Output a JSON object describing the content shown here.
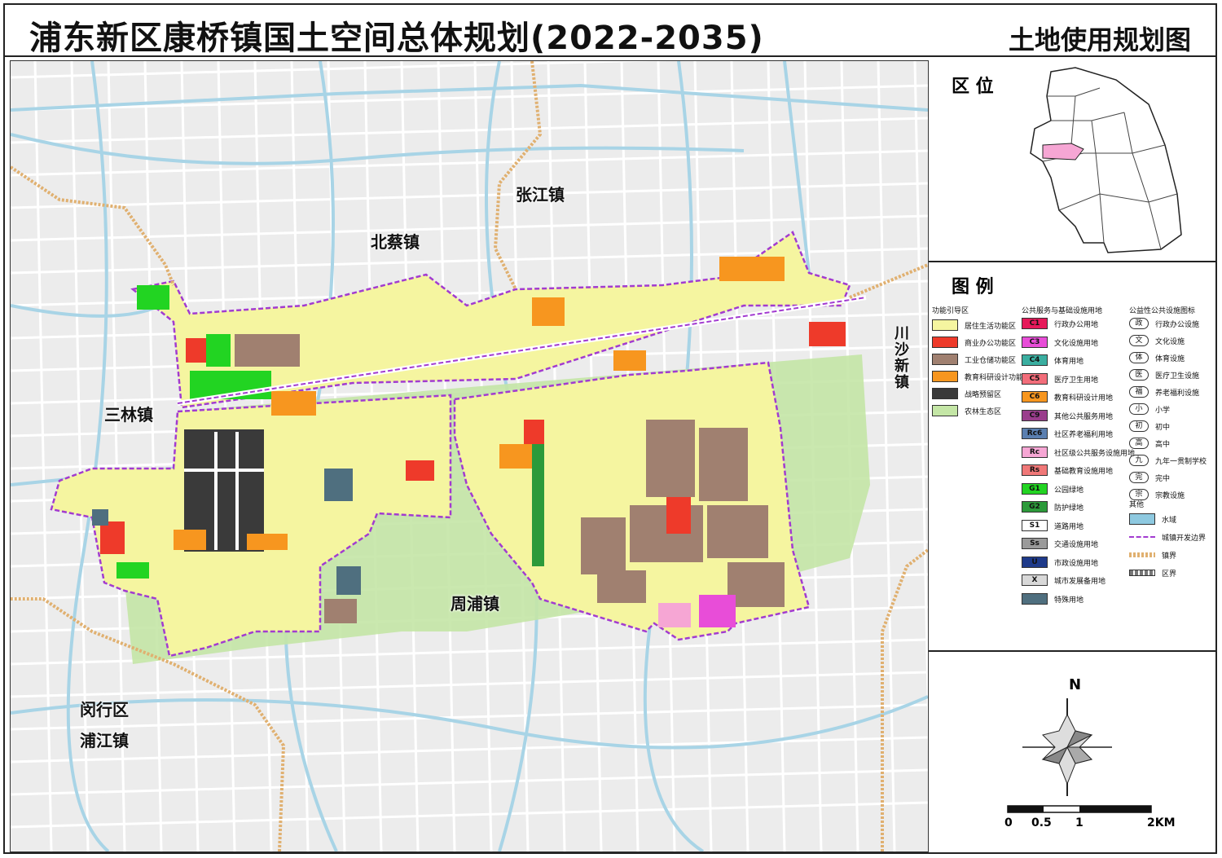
{
  "header": {
    "title": "浦东新区康桥镇国土空间总体规划(2022-2035)",
    "subtitle": "土地使用规划图"
  },
  "map": {
    "town_labels": [
      {
        "id": "zhangjiang",
        "text": "张江镇"
      },
      {
        "id": "beicai",
        "text": "北蔡镇"
      },
      {
        "id": "sanlin",
        "text": "三林镇"
      },
      {
        "id": "zhoupu",
        "text": "周浦镇"
      },
      {
        "id": "chuansha",
        "text": "川沙新镇"
      },
      {
        "id": "minhang",
        "text": "闵行区"
      },
      {
        "id": "pujiang",
        "text": "浦江镇"
      }
    ]
  },
  "location": {
    "title": "区 位"
  },
  "legend": {
    "title": "图 例",
    "function_zones": {
      "heading": "功能引导区",
      "items": [
        {
          "label": "居住生活功能区",
          "color": "#f5f5a0"
        },
        {
          "label": "商业办公功能区",
          "color": "#ee3a2a"
        },
        {
          "label": "工业仓储功能区",
          "color": "#a08070"
        },
        {
          "label": "教育科研设计功能区",
          "color": "#f7961f"
        },
        {
          "label": "战略预留区",
          "color": "#3a3a3a"
        },
        {
          "label": "农林生态区",
          "color": "#c4e6a6"
        }
      ]
    },
    "public_service": {
      "heading": "公共服务与基础设施用地",
      "items": [
        {
          "code": "C1",
          "label": "行政办公用地",
          "color": "#e6195a"
        },
        {
          "code": "C3",
          "label": "文化设施用地",
          "color": "#e84dd8"
        },
        {
          "code": "C4",
          "label": "体育用地",
          "color": "#3aaea0"
        },
        {
          "code": "C5",
          "label": "医疗卫生用地",
          "color": "#f26d7a"
        },
        {
          "code": "C6",
          "label": "教育科研设计用地",
          "color": "#f7961f"
        },
        {
          "code": "C9",
          "label": "其他公共服务用地",
          "color": "#9a3d8c"
        },
        {
          "code": "Rc6",
          "label": "社区养老福利用地",
          "color": "#5a7fb0"
        },
        {
          "code": "Rc",
          "label": "社区级公共服务设施用地",
          "color": "#f6a6d4"
        },
        {
          "code": "Rs",
          "label": "基础教育设施用地",
          "color": "#f07878"
        },
        {
          "code": "G1",
          "label": "公园绿地",
          "color": "#22d422"
        },
        {
          "code": "G2",
          "label": "防护绿地",
          "color": "#2c9a3a"
        },
        {
          "code": "S1",
          "label": "道路用地",
          "color": "#ffffff"
        },
        {
          "code": "Ss",
          "label": "交通设施用地",
          "color": "#9a9a9a"
        },
        {
          "code": "U",
          "label": "市政设施用地",
          "color": "#1e3a8a"
        },
        {
          "code": "X",
          "label": "城市发展备用地",
          "color": "#d8d8d8"
        },
        {
          "code": "",
          "label": "特殊用地",
          "color": "#4f6f7f"
        }
      ]
    },
    "facilities": {
      "heading": "公益性公共设施图标",
      "items": [
        {
          "icon": "政",
          "label": "行政办公设施"
        },
        {
          "icon": "文",
          "label": "文化设施"
        },
        {
          "icon": "体",
          "label": "体育设施"
        },
        {
          "icon": "医",
          "label": "医疗卫生设施"
        },
        {
          "icon": "福",
          "label": "养老福利设施"
        },
        {
          "icon": "小",
          "label": "小学"
        },
        {
          "icon": "初",
          "label": "初中"
        },
        {
          "icon": "高",
          "label": "高中"
        },
        {
          "icon": "九",
          "label": "九年一贯制学校"
        },
        {
          "icon": "完",
          "label": "完中"
        },
        {
          "icon": "宗",
          "label": "宗教设施"
        }
      ]
    },
    "other": {
      "heading": "其他",
      "items": [
        {
          "label": "水域",
          "style": "water",
          "color": "#8ec9e0"
        },
        {
          "label": "城镇开发边界",
          "style": "boundary",
          "color": "#a23bd0"
        },
        {
          "label": "镇界",
          "style": "town",
          "color": "#e0b070"
        },
        {
          "label": "区界",
          "style": "district",
          "color": "#777777"
        }
      ]
    }
  },
  "compass": {
    "north": "N",
    "scale": [
      "0",
      "0.5",
      "1",
      "2KM"
    ]
  },
  "colors": {
    "water": "#a8d4e6",
    "road": "#ffffff",
    "block": "#e8e8e8",
    "boundary": "#a23bd0"
  }
}
